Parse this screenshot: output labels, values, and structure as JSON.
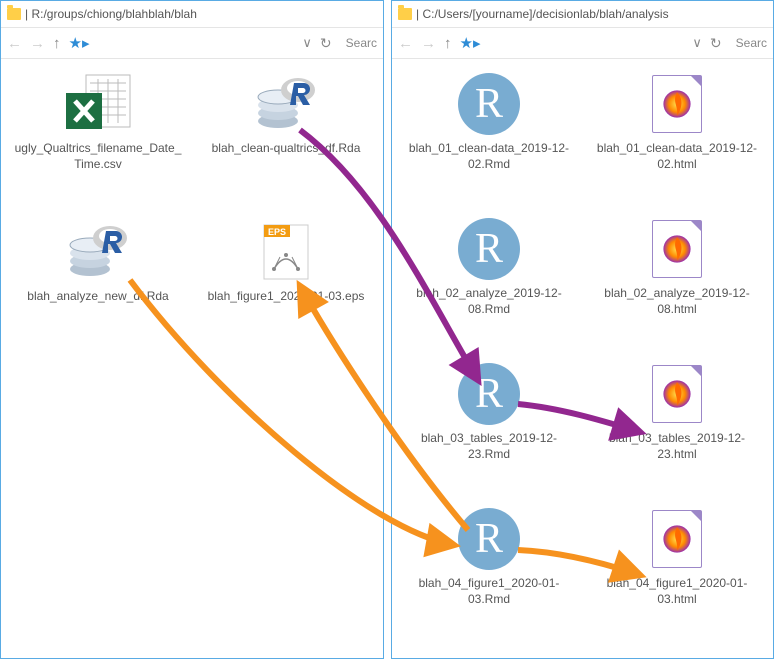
{
  "leftWindow": {
    "title": "R:/groups/chiong/blahblah/blah",
    "searchPlaceholder": "Searc",
    "files": [
      {
        "name": "ugly_Qualtrics_filename_Date_Time.csv",
        "type": "csv"
      },
      {
        "name": "blah_clean-qualtrics_df.Rda",
        "type": "rda"
      },
      {
        "name": "blah_analyze_new_df.Rda",
        "type": "rda"
      },
      {
        "name": "blah_figure1_2020-01-03.eps",
        "type": "eps"
      }
    ]
  },
  "rightWindow": {
    "title": "C:/Users/[yourname]/decisionlab/blah/analysis",
    "searchPlaceholder": "Searc",
    "files": [
      {
        "name": "blah_01_clean-data_2019-12-02.Rmd",
        "type": "rmd"
      },
      {
        "name": "blah_01_clean-data_2019-12-02.html",
        "type": "html"
      },
      {
        "name": "blah_02_analyze_2019-12-08.Rmd",
        "type": "rmd"
      },
      {
        "name": "blah_02_analyze_2019-12-08.html",
        "type": "html"
      },
      {
        "name": "blah_03_tables_2019-12-23.Rmd",
        "type": "rmd"
      },
      {
        "name": "blah_03_tables_2019-12-23.html",
        "type": "html"
      },
      {
        "name": "blah_04_figure1_2020-01-03.Rmd",
        "type": "rmd"
      },
      {
        "name": "blah_04_figure1_2020-01-03.html",
        "type": "html"
      }
    ]
  }
}
